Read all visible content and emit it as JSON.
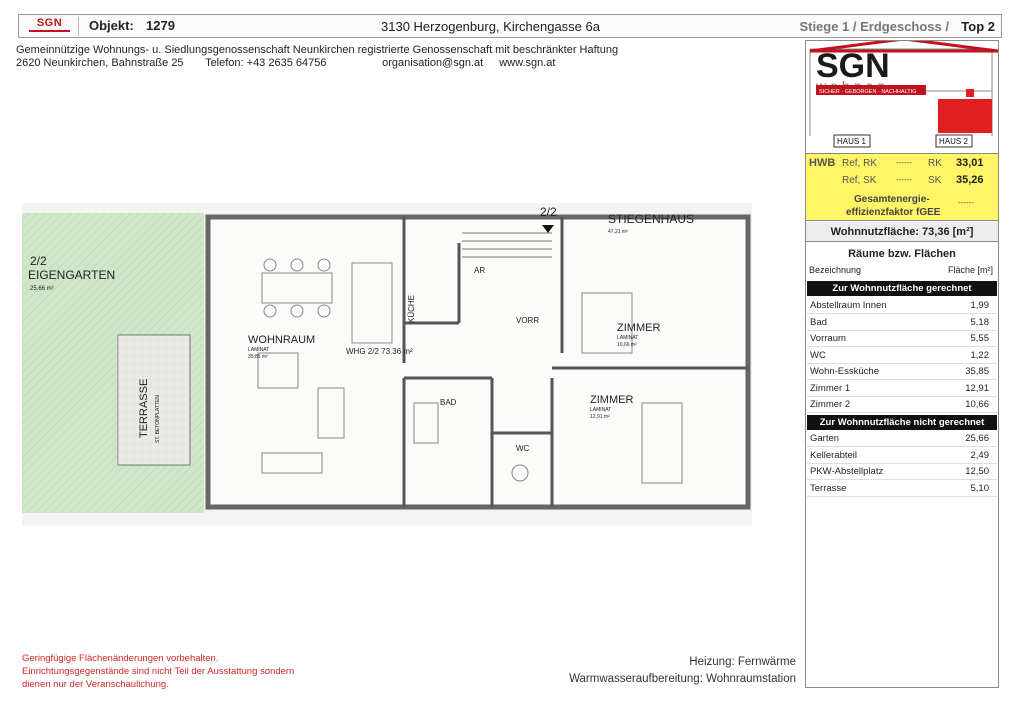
{
  "header": {
    "logo_text": "SGN",
    "objekt_label": "Objekt:",
    "objekt_number": "1279",
    "address": "3130 Herzogenburg, Kirchengasse 6a",
    "location": "Stiege 1 / Erdgeschoss /",
    "top": "Top 2"
  },
  "cooperative": {
    "name": "Gemeinnützige Wohnungs- u. Siedlungsgenossenschaft Neunkirchen registrierte Genossenschaft mit beschränkter Haftung",
    "street": "2620 Neunkirchen, Bahnstraße 25",
    "phone": "Telefon: +43 2635  64756",
    "email": "organisation@sgn.at",
    "web": "www.sgn.at"
  },
  "plan": {
    "labels": {
      "eigengarten_num": "2/2",
      "eigengarten": "EIGENGARTEN",
      "eigengarten_area": "25,66 m²",
      "terrasse": "TERRASSE",
      "terrasse_sub": "ST. BETONPLATTEN",
      "wohnraum": "WOHNRAUM",
      "wohnraum_sub": "LAMINAT",
      "wohnraum_area": "35,85 m²",
      "kueche": "KÜCHE",
      "whg": "WHG 2/2 73.36 m²",
      "ar": "AR",
      "vorr": "VORR",
      "bad": "BAD",
      "wc": "WC",
      "zimmer1": "ZIMMER",
      "zimmer1_sub": "LAMINAT",
      "zimmer1_area": "10,66 m²",
      "zimmer2": "ZIMMER",
      "zimmer2_sub": "LAMINAT",
      "zimmer2_area": "12,91 m²",
      "stiegenhaus": "STIEGENHAUS",
      "stiegenhaus_num": "2/2",
      "stiegenhaus_area": "47,21 m²"
    }
  },
  "sidebar": {
    "brand": "SGN",
    "brand_sub": "wohnen",
    "tagline": "SICHER · GEBORGEN · NACHHALTIG",
    "haus1": "HAUS 1",
    "haus2": "HAUS 2",
    "hwb": {
      "label": "HWB",
      "ref_rk": "Ref, RK",
      "dash1": "------",
      "rk": "RK",
      "rk_value": "33,01",
      "ref_sk": "Ref, SK",
      "dash2": "------",
      "sk": "SK",
      "sk_value": "35,26",
      "fgee_line1": "Gesamtenergie-",
      "fgee_line2": "effizienzfaktor fGEE",
      "fgee_value": "------"
    },
    "wohnnutzflaeche": "Wohnnutzfläche: 73,36 [m²]",
    "rooms_title": "Räume bzw. Flächen",
    "col_name": "Bezeichnung",
    "col_area": "Fläche [m²]",
    "group1": "Zur Wohnnutzfläche gerechnet",
    "rooms1": [
      {
        "name": "Abstellraum Innen",
        "area": "1,99"
      },
      {
        "name": "Bad",
        "area": "5,18"
      },
      {
        "name": "Vorraum",
        "area": "5,55"
      },
      {
        "name": "WC",
        "area": "1,22"
      },
      {
        "name": "Wohn-Essküche",
        "area": "35,85"
      },
      {
        "name": "Zimmer 1",
        "area": "12,91"
      },
      {
        "name": "Zimmer 2",
        "area": "10,66"
      }
    ],
    "group2": "Zur Wohnnutzfläche nicht gerechnet",
    "rooms2": [
      {
        "name": "Garten",
        "area": "25,66"
      },
      {
        "name": "Kellerabteil",
        "area": "2,49"
      },
      {
        "name": "PKW-Abstellplatz",
        "area": "12,50"
      },
      {
        "name": "Terrasse",
        "area": "5,10"
      }
    ]
  },
  "footer": {
    "note_line1": "Geringfügige Flächenänderungen vorbehalten.",
    "note_line2": "Einrichtungsgegenstände sind nicht Teil der Ausstattung sondern",
    "note_line3": "dienen nur der Veranschaulichung.",
    "heizung": "Heizung: Fernwärme",
    "warmwasser": "Warmwasseraufbereitung: Wohnraumstation"
  }
}
